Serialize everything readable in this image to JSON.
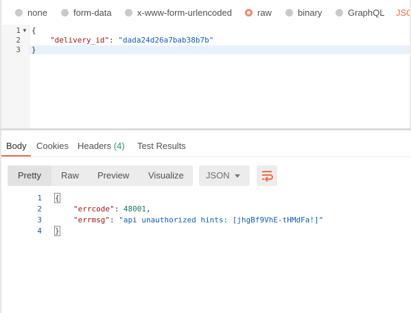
{
  "body_types": {
    "options": [
      {
        "label": "none",
        "selected": false
      },
      {
        "label": "form-data",
        "selected": false
      },
      {
        "label": "x-www-form-urlencoded",
        "selected": false
      },
      {
        "label": "raw",
        "selected": true
      },
      {
        "label": "binary",
        "selected": false
      },
      {
        "label": "GraphQL",
        "selected": false
      }
    ],
    "format_label": "JSON"
  },
  "request_editor": {
    "lines": [
      {
        "num": "1",
        "text": "{"
      },
      {
        "num": "2",
        "key": "\"delivery_id\"",
        "sep": ": ",
        "value": "\"dada24d26a7bab38b7b\""
      },
      {
        "num": "3",
        "text": "}"
      }
    ]
  },
  "response_tabs": [
    {
      "label": "Body",
      "active": true
    },
    {
      "label": "Cookies",
      "active": false
    },
    {
      "label": "Headers",
      "count": "(4)",
      "active": false
    },
    {
      "label": "Test Results",
      "active": false
    }
  ],
  "view_modes": [
    "Pretty",
    "Raw",
    "Preview",
    "Visualize"
  ],
  "active_view_mode": "Pretty",
  "response_format": "JSON",
  "response_body": {
    "lines": [
      {
        "num": "1",
        "text": "{"
      },
      {
        "num": "2",
        "key": "\"errcode\"",
        "sep": ": ",
        "value": "48001",
        "tail": ","
      },
      {
        "num": "3",
        "key": "\"errmsg\"",
        "sep": ": ",
        "value": "\"api unauthorized hints: [jhgBf9VhE-tHMdFa!]\""
      },
      {
        "num": "4",
        "text": "}"
      }
    ]
  },
  "colors": {
    "accent": "#f26b3a",
    "count_green": "#1e9e52",
    "json_key": "#a31515",
    "json_string": "#0f5db5",
    "json_number": "#0f7a5a"
  },
  "icons": {
    "fold": "chevron-down-icon",
    "wrap": "wrap-lines-icon",
    "dropdown": "caret-down-icon"
  }
}
